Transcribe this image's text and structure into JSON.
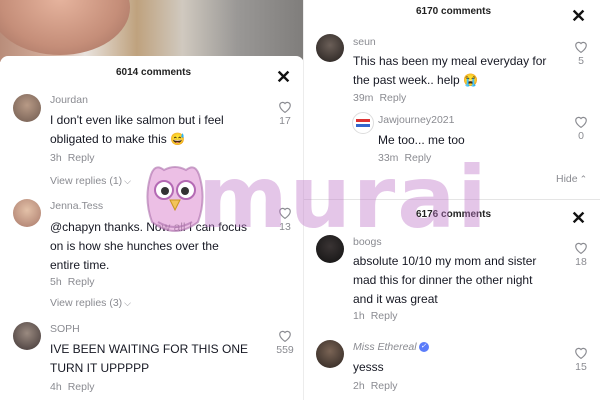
{
  "left": {
    "header": "6014 comments",
    "comments": [
      {
        "user": "Jourdan",
        "text": [
          "I don't even like salmon but i feel",
          "obligated to make this 😅"
        ],
        "time": "3h",
        "reply": "Reply",
        "likes": "17",
        "view_replies": "View replies (1)"
      },
      {
        "user": "Jenna.Tess",
        "text": [
          "@chapyn thanks. Now all I can focus",
          "on is how she hunches over the",
          "entire time."
        ],
        "time": "5h",
        "reply": "Reply",
        "likes": "13",
        "view_replies": "View replies (3)"
      },
      {
        "user": "SOPH",
        "text": [
          "IVE BEEN WAITING FOR THIS ONE",
          "TURN IT UPPPPP"
        ],
        "time": "4h",
        "reply": "Reply",
        "likes": "559"
      }
    ]
  },
  "right_top": {
    "header": "6170 comments",
    "comments": [
      {
        "user": "seun",
        "text": [
          "This has been my meal everyday for",
          "the past week.. help 😭"
        ],
        "time": "39m",
        "reply": "Reply",
        "likes": "5"
      },
      {
        "user": "Jawjourney2021",
        "text": [
          "Me too... me too"
        ],
        "time": "33m",
        "reply": "Reply",
        "likes": "0"
      }
    ],
    "hide_label": "Hide"
  },
  "right_bottom": {
    "header": "6176 comments",
    "comments": [
      {
        "user": "boogs",
        "text": [
          "absolute 10/10 my mom and sister",
          "mad this for dinner the other night",
          "and it was great"
        ],
        "time": "1h",
        "reply": "Reply",
        "likes": "18"
      },
      {
        "user": "Miss Ethereal",
        "text": [
          "yesss"
        ],
        "time": "2h",
        "reply": "Reply",
        "likes": "15"
      }
    ]
  },
  "watermark": "murai",
  "close_glyph": "✕",
  "chevron_down": "⌵",
  "chevron_up": "⌃",
  "verified_glyph": "✓"
}
